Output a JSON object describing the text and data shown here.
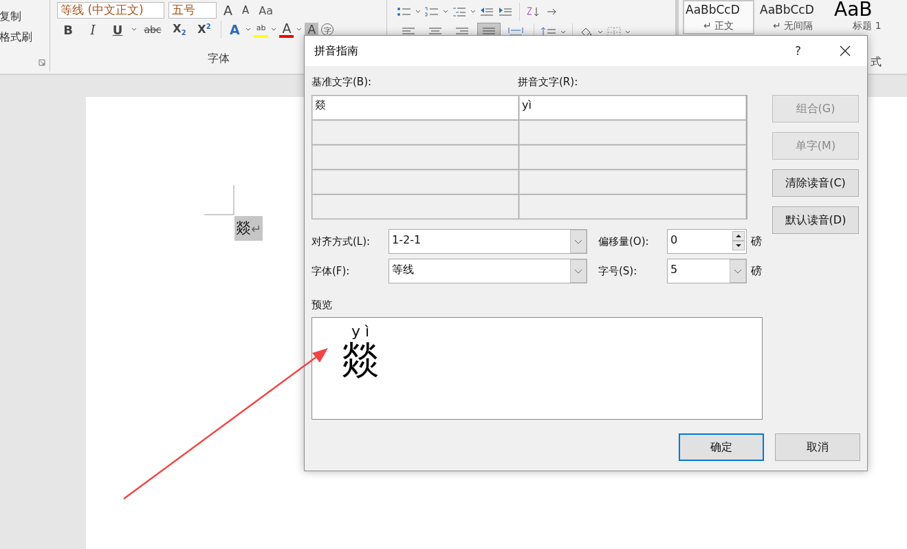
{
  "ribbon": {
    "clipboard": {
      "items": [
        "复制",
        "格式刷"
      ]
    },
    "font_group": {
      "font_name": "等线 (中文正文)",
      "font_size": "五号",
      "size_buttons": [
        {
          "kind": "grow",
          "label": "A"
        },
        {
          "kind": "shrink",
          "label": "A"
        }
      ],
      "case_button": "Aa",
      "format_buttons": [
        {
          "kind": "bold",
          "label": "B"
        },
        {
          "kind": "italic",
          "label": "I"
        },
        {
          "kind": "underline",
          "label": "U"
        },
        {
          "kind": "strike",
          "label": "abc"
        },
        {
          "kind": "sub",
          "label": "X$_{2}$"
        },
        {
          "kind": "sup",
          "label": "X$^{2}$"
        }
      ],
      "effect_buttons": [
        {
          "kind": "effects",
          "label": "A"
        },
        {
          "kind": "highlight",
          "label": "ab"
        },
        {
          "kind": "color",
          "label": "A"
        },
        {
          "kind": "shading",
          "label": "A"
        },
        {
          "kind": "enclose",
          "label": "字"
        }
      ],
      "label": "字体"
    },
    "paragraph_group": {
      "alignments": [
        {
          "kind": "left",
          "selected": false
        },
        {
          "kind": "center",
          "selected": false
        },
        {
          "kind": "right",
          "selected": false
        },
        {
          "kind": "justify",
          "selected": true
        },
        {
          "kind": "distribute",
          "selected": false
        }
      ]
    },
    "styles": [
      {
        "sample": "AaBbCcD",
        "name": "↵ 正文",
        "selected": true,
        "kind": "normal"
      },
      {
        "sample": "AaBbCcD",
        "name": "↵ 无间隔",
        "selected": false,
        "kind": "normal"
      },
      {
        "sample": "AaB",
        "name": "标题 1",
        "selected": false,
        "kind": "heading"
      }
    ],
    "styles_label": "式"
  },
  "document": {
    "text": "燚",
    "paragraph_mark": "↵",
    "selected": true
  },
  "annotation": {
    "kind": "arrow"
  },
  "dialog": {
    "title": "拼音指南",
    "help": "?",
    "base_label": "基准文字(B):",
    "ruby_label": "拼音文字(R):",
    "rows": [
      {
        "base": "燚",
        "ruby": "yì",
        "enabled": true
      },
      {
        "enabled": false
      },
      {
        "enabled": false
      },
      {
        "enabled": false
      },
      {
        "enabled": false
      }
    ],
    "side_buttons": [
      {
        "label": "组合(G)",
        "disabled": true
      },
      {
        "label": "单字(M)",
        "disabled": true
      },
      {
        "label": "清除读音(C)",
        "disabled": false
      },
      {
        "label": "默认读音(D)",
        "disabled": false
      }
    ],
    "alignment": {
      "label": "对齐方式(L):",
      "value": "1-2-1"
    },
    "offset": {
      "label": "偏移量(O):",
      "value": "0",
      "unit": "磅"
    },
    "font": {
      "label": "字体(F):",
      "value": "等线"
    },
    "size": {
      "label": "字号(S):",
      "value": "5",
      "unit": "磅"
    },
    "preview": {
      "label": "预览",
      "ruby": "y ì",
      "base": "燚"
    },
    "buttons": [
      {
        "label": "确定",
        "default": true
      },
      {
        "label": "取消",
        "default": false
      }
    ]
  }
}
